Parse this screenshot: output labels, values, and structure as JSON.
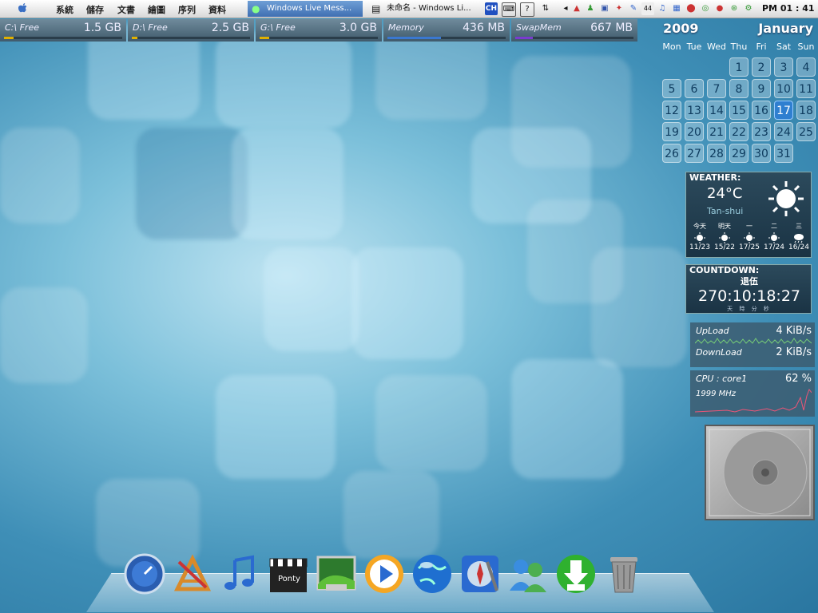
{
  "menubar": {
    "menus": [
      "系統",
      "儲存",
      "文書",
      "繪圖",
      "序列",
      "資料"
    ],
    "tasks": [
      "Windows Live Mess...",
      "未命名 - Windows Li..."
    ],
    "tray_input": "CH",
    "tray_badge": "44",
    "clock": "PM 01 : 41"
  },
  "drives": [
    {
      "label": "C:\\ Free",
      "value": "1.5 GB",
      "color": "#e0b000"
    },
    {
      "label": "D:\\ Free",
      "value": "2.5 GB",
      "color": "#e0b000"
    },
    {
      "label": "G:\\ Free",
      "value": "3.0 GB",
      "color": "#e0b000"
    },
    {
      "label": "Memory",
      "value": "436 MB",
      "color": "#3a78d0"
    },
    {
      "label": "SwapMem",
      "value": "667 MB",
      "color": "#7a3ad0"
    }
  ],
  "calendar": {
    "year": "2009",
    "month": "January",
    "weekdays": [
      "Mon",
      "Tue",
      "Wed",
      "Thu",
      "Fri",
      "Sat",
      "Sun"
    ],
    "first_weekday_index": 3,
    "days_in_month": 31,
    "today": 17
  },
  "weather": {
    "title": "WEATHER:",
    "temp": "24°C",
    "city": "Tan-shui",
    "forecast": [
      {
        "day": "今天",
        "range": "11/23",
        "icon": "sun-icon"
      },
      {
        "day": "明天",
        "range": "15/22",
        "icon": "sun-icon"
      },
      {
        "day": "一",
        "range": "17/25",
        "icon": "sun-icon"
      },
      {
        "day": "二",
        "range": "17/24",
        "icon": "sun-icon"
      },
      {
        "day": "三",
        "range": "16/24",
        "icon": "rain-icon"
      }
    ]
  },
  "countdown": {
    "title": "COUNTDOWN:",
    "event": "退伍",
    "time": "270:10:18:27",
    "units": "天 時 分 秒"
  },
  "network": {
    "upload_label": "UpLoad",
    "upload_value": "4 KiB/s",
    "download_label": "DownLoad",
    "download_value": "2 KiB/s"
  },
  "cpu": {
    "label": "CPU : core1",
    "percent": "62 %",
    "freq": "1999 MHz"
  },
  "dock": [
    "dashboard-icon",
    "app-store-icon",
    "itunes-icon",
    "clapperboard-icon",
    "photo-icon",
    "media-player-icon",
    "globe-icon",
    "safari-icon",
    "messenger-icon",
    "download-icon",
    "trash-icon"
  ]
}
